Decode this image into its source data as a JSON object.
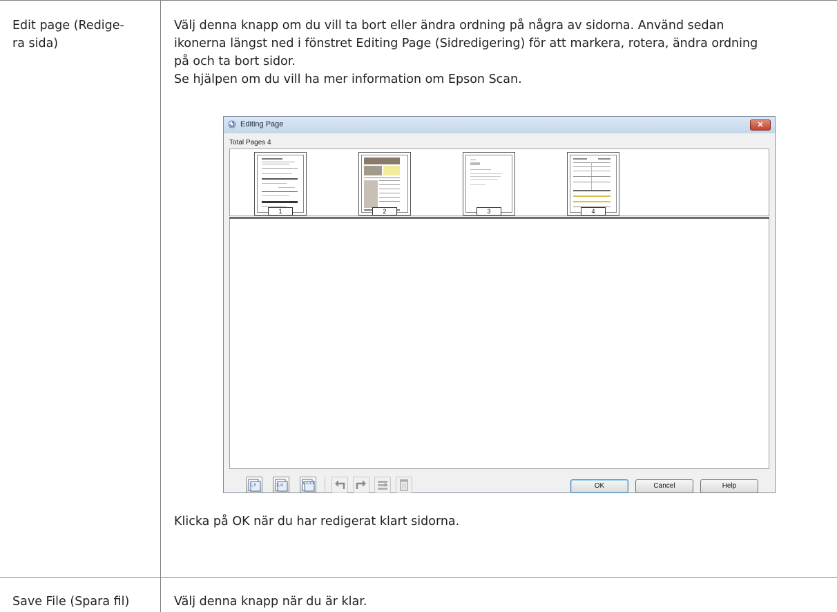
{
  "rows": [
    {
      "label": "Edit page (Redige-\nra sida)",
      "label_line1": "Edit page (Redige-",
      "label_line2": "ra sida)",
      "desc_line1": "Välj denna knapp om du vill ta bort eller ändra ordning på några av sidorna. Använd sedan",
      "desc_line2": "ikonerna längst ned i fönstret Editing Page (Sidredigering) för att markera, rotera, ändra ordning",
      "desc_line3": "på och ta bort sidor.",
      "desc_line4": "Se hjälpen om du vill ha mer information om Epson Scan.",
      "after_screenshot": "Klicka på OK när du har redigerat klart sidorna."
    },
    {
      "label": "Save File (Spara fil)",
      "desc": "Välj denna knapp när du är klar."
    }
  ],
  "window": {
    "title": "Editing Page",
    "total_pages": "Total Pages 4",
    "pages": [
      "1",
      "2",
      "3",
      "4"
    ],
    "toolbar": {
      "ok": "OK",
      "cancel": "Cancel",
      "help": "Help",
      "odd_pages_icon_label": "1,3",
      "even_pages_icon_label": "2,4",
      "all_pages_icon_label": "1,2,3,4"
    },
    "colors": {
      "title_bar": "#c6d6ea",
      "close_button": "#c0412b",
      "default_button_border": "#3c7fb1"
    }
  }
}
